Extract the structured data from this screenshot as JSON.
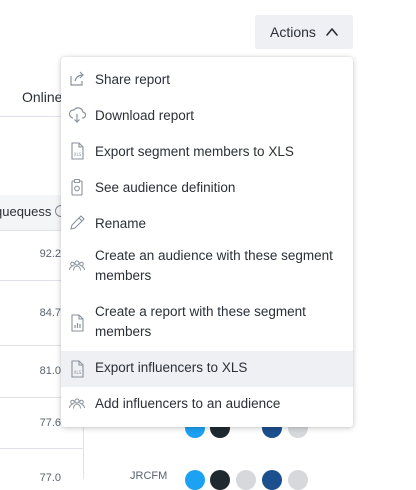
{
  "actions_button": {
    "label": "Actions"
  },
  "background": {
    "column_header": "Online",
    "table_header": "quequess",
    "values": [
      "92.2",
      "84.7",
      "81.0",
      "77.6",
      "77.0"
    ],
    "bottom_id": "JRCFM"
  },
  "menu": {
    "items": [
      {
        "label": "Share report",
        "icon": "share-icon"
      },
      {
        "label": "Download report",
        "icon": "download-icon"
      },
      {
        "label": "Export segment members to XLS",
        "icon": "xls-file-icon"
      },
      {
        "label": "See audience definition",
        "icon": "clipboard-icon"
      },
      {
        "label": "Rename",
        "icon": "pencil-icon"
      },
      {
        "label": "Create an audience with these segment members",
        "icon": "group-icon"
      },
      {
        "label": "Create a report with these segment members",
        "icon": "report-file-icon"
      },
      {
        "label": "Export influencers to XLS",
        "icon": "xls-file-icon",
        "highlighted": true
      },
      {
        "label": "Add influencers to an audience",
        "icon": "group-icon"
      }
    ]
  },
  "colors": {
    "twitter": "#1da1f2",
    "instagram": "#1f2a30",
    "facebook": "#1c4f8e",
    "muted": "#d6d8db"
  }
}
